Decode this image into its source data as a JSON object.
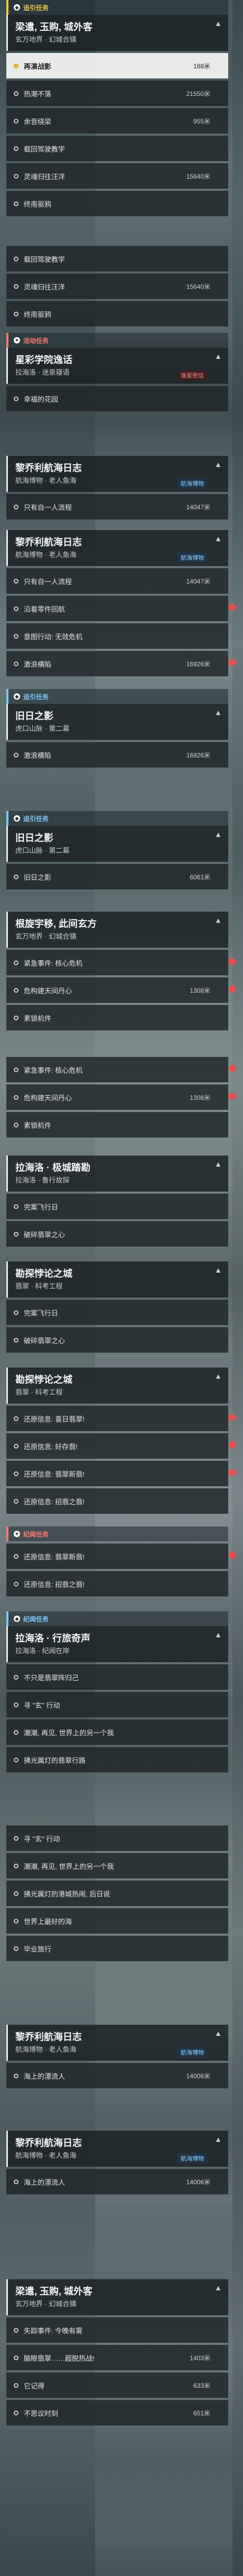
{
  "headers": {
    "h1": "追引任务",
    "h2": "活动任务",
    "h3": "追引任务",
    "h4": "追引任务",
    "h5": "纪闻任务",
    "h6": "纪闻任务"
  },
  "cards": {
    "c1": {
      "title": "梁遣, 玉购, 城外客",
      "sub": "玄万地界 · 幻城合镇"
    },
    "c2": {
      "title": "星彩学院逸话",
      "sub": "拉海洛 · 迷泉寝语",
      "badge": "谁星密信"
    },
    "c3": {
      "title": "黎乔利航海日志",
      "sub": "航海博物 · 老人鱼海",
      "badge": "航海博物"
    },
    "c4": {
      "title": "黎乔利航海日志",
      "sub": "航海博物 · 老人鱼海",
      "badge": "航海博物"
    },
    "c5": {
      "title": "旧日之影",
      "sub": "虎口山脉 · 第二幕"
    },
    "c6": {
      "title": "旧日之影",
      "sub": "虎口山脉 · 第二幕"
    },
    "c7": {
      "title": "根旋宇移, 此间玄方",
      "sub": "玄万地界 · 幻城合镇"
    },
    "c8": {
      "title": "拉海洛 · 极城踏勘",
      "sub": "拉海洛 · 鲁行故探"
    },
    "c9": {
      "title": "勘探悖论之城",
      "sub": "翡翠 · 科考工程"
    },
    "c10": {
      "title": "勘探悖论之城",
      "sub": "翡翠 · 科考工程"
    },
    "c11": {
      "title": "拉海洛 · 行旅奇声",
      "sub": "拉海洛 · 纪闻在岸"
    },
    "c12": {
      "title": "黎乔利航海日志",
      "sub": "航海博物 · 老人鱼海",
      "badge": "航海博物"
    },
    "c13": {
      "title": "黎乔利航海日志",
      "sub": "航海博物 · 老人鱼海",
      "badge": "航海博物"
    },
    "c14": {
      "title": "梁遣, 玉购, 城外客",
      "sub": "玄万地界 · 幻城合镇"
    }
  },
  "rows": {
    "r1": {
      "label": "再演战影",
      "dist": "188米"
    },
    "r2": {
      "label": "热潮不落",
      "dist": "21550米"
    },
    "r3": {
      "label": "余音绕梁",
      "dist": "955米"
    },
    "r4": {
      "label": "载回驾驶教学",
      "dist": ""
    },
    "r5": {
      "label": "灵魂归往汪洋",
      "dist": "15640米"
    },
    "r6": {
      "label": "终南驱鸦",
      "dist": ""
    },
    "r7": {
      "label": "载回驾驶教学",
      "dist": ""
    },
    "r8": {
      "label": "灵魂归往汪洋",
      "dist": "15640米"
    },
    "r9": {
      "label": "终南驱鸦",
      "dist": ""
    },
    "r10": {
      "label": "幸福的花园",
      "dist": ""
    },
    "r11": {
      "label": "只有自一人流程",
      "dist": "14047米"
    },
    "r12": {
      "label": "只有自一人流程",
      "dist": "14047米"
    },
    "r13": {
      "label": "沿着零件回航",
      "dist": ""
    },
    "r14": {
      "label": "意图行动: 无效危机",
      "dist": ""
    },
    "r15": {
      "label": "激浪横陷",
      "dist": "16926米"
    },
    "r16": {
      "label": "激浪横陷",
      "dist": "16926米"
    },
    "r17": {
      "label": "旧日之影",
      "dist": "6061米"
    },
    "r18": {
      "label": "紧急事件: 核心危机",
      "dist": ""
    },
    "r19": {
      "label": "危构建天间丹心",
      "dist": "1308米"
    },
    "r20": {
      "label": "素锁机件",
      "dist": ""
    },
    "r21": {
      "label": "紧急事件: 核心危机",
      "dist": ""
    },
    "r22": {
      "label": "危构建天间丹心",
      "dist": "1308米"
    },
    "r23": {
      "label": "素锁机件",
      "dist": ""
    },
    "r24": {
      "label": "完案飞行日",
      "dist": ""
    },
    "r25": {
      "label": "破碎翡翠之心",
      "dist": ""
    },
    "r26": {
      "label": "完案飞行日",
      "dist": ""
    },
    "r27": {
      "label": "破碎翡翠之心",
      "dist": ""
    },
    "r28": {
      "label": "还原信息: 喜日翡翠!",
      "dist": ""
    },
    "r29": {
      "label": "还原信息: 好存翡!",
      "dist": ""
    },
    "r30": {
      "label": "还原信息: 翡翠新翡!",
      "dist": ""
    },
    "r31": {
      "label": "还原信息: 招翡之翡!",
      "dist": ""
    },
    "r32": {
      "label": "还原信息: 翡翠新翡!",
      "dist": ""
    },
    "r33": {
      "label": "还原信息: 招翡之翡!",
      "dist": ""
    },
    "r34": {
      "label": "不只是翡翠阵归己",
      "dist": ""
    },
    "r35": {
      "label": "寻 \"玄\" 行动",
      "dist": ""
    },
    "r36": {
      "label": "潮潮, 再见, 世界上的另一个我",
      "dist": ""
    },
    "r37": {
      "label": "拂光属灯的翡翠行路",
      "dist": ""
    },
    "r38": {
      "label": "寻 \"玄\" 行动",
      "dist": ""
    },
    "r39": {
      "label": "潮潮, 再见, 世界上的另一个我",
      "dist": ""
    },
    "r40": {
      "label": "拂光属灯的港城热闹, 后日说",
      "dist": ""
    },
    "r41": {
      "label": "世界上最好的海",
      "dist": ""
    },
    "r42": {
      "label": "毕业旅行",
      "dist": ""
    },
    "r43": {
      "label": "海上的漂流人",
      "dist": "14006米"
    },
    "r44": {
      "label": "海上的漂流人",
      "dist": "14006米"
    },
    "r45": {
      "label": "失踪事件: 今晚有雾",
      "dist": ""
    },
    "r46": {
      "label": "脑眼翡翠……超脱热战!",
      "dist": "1403米"
    },
    "r47": {
      "label": "它记得",
      "dist": "633米"
    },
    "r48": {
      "label": "不思议时刻",
      "dist": "651米"
    }
  }
}
